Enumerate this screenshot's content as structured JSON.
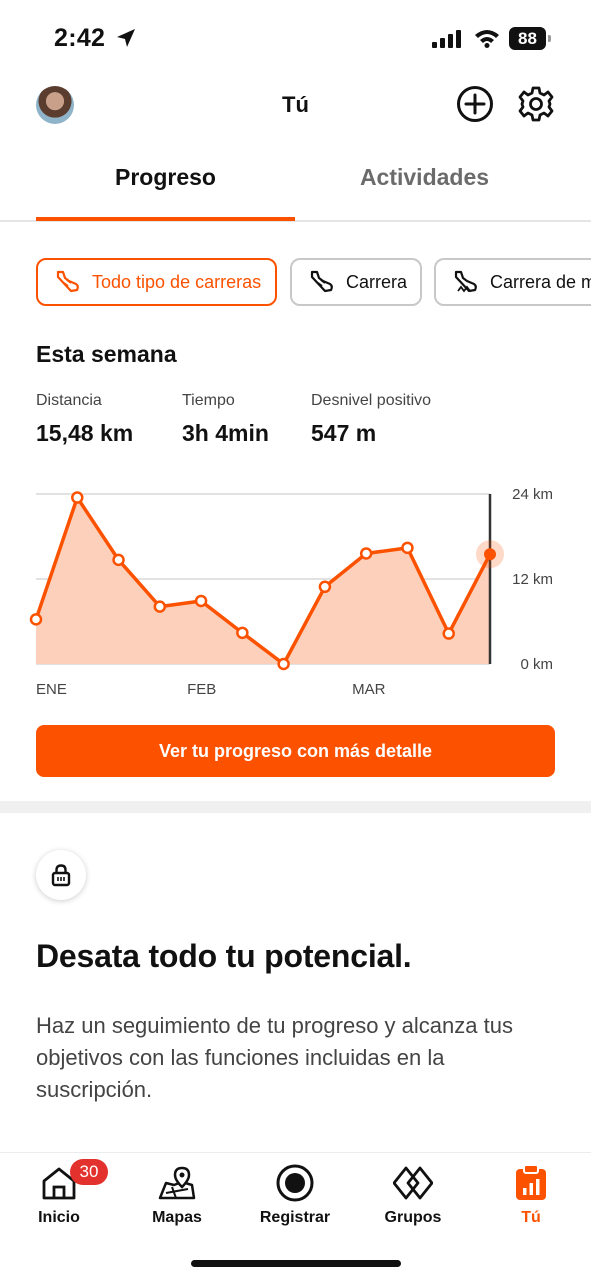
{
  "status_bar": {
    "time": "2:42",
    "battery": "88"
  },
  "header": {
    "title": "Tú"
  },
  "tabs": [
    {
      "label": "Progreso"
    },
    {
      "label": "Actividades"
    }
  ],
  "filters": [
    {
      "label": "Todo tipo de carreras",
      "selected": true
    },
    {
      "label": "Carrera",
      "selected": false
    },
    {
      "label": "Carrera de m",
      "selected": false
    }
  ],
  "week": {
    "title": "Esta semana",
    "stats": [
      {
        "label": "Distancia",
        "value": "15,48 km"
      },
      {
        "label": "Tiempo",
        "value": "3h 4min"
      },
      {
        "label": "Desnivel positivo",
        "value": "547 m"
      }
    ]
  },
  "chart_data": {
    "type": "area",
    "x_tick_labels": [
      "ENE",
      "FEB",
      "MAR"
    ],
    "y_tick_labels": [
      "24 km",
      "12 km",
      "0 km"
    ],
    "ylim": [
      0,
      24
    ],
    "y_unit": "km",
    "values": [
      6.3,
      23.5,
      14.7,
      8.1,
      8.9,
      4.4,
      0,
      10.9,
      15.6,
      16.4,
      4.3,
      15.5
    ],
    "highlight_index": 11,
    "grid": true,
    "colors": {
      "line": "#fc5200",
      "fill": "#fdd0bb",
      "grid": "#d9d9d9",
      "cursor": "#333333"
    }
  },
  "cta": {
    "label": "Ver tu progreso con más detalle"
  },
  "promo": {
    "title": "Desata todo tu potencial.",
    "body": "Haz un seguimiento de tu progreso y alcanza tus objetivos con las funciones incluidas en la suscripción."
  },
  "bottom_nav": [
    {
      "label": "Inicio",
      "icon": "home-icon",
      "badge": "30"
    },
    {
      "label": "Mapas",
      "icon": "map-icon"
    },
    {
      "label": "Registrar",
      "icon": "record-icon"
    },
    {
      "label": "Grupos",
      "icon": "groups-icon"
    },
    {
      "label": "Tú",
      "icon": "you-icon",
      "active": true
    }
  ],
  "colors": {
    "accent": "#fc5200",
    "badge": "#e3312d"
  }
}
